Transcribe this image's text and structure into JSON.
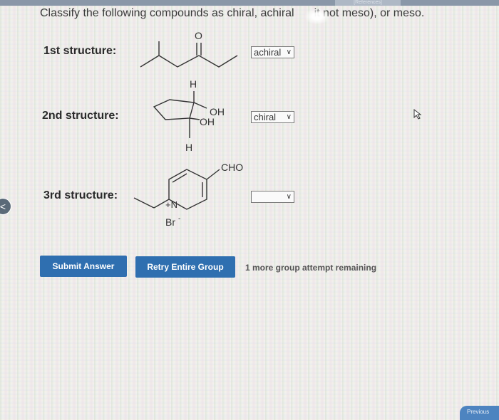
{
  "header": {
    "tab_text": "[References]"
  },
  "question": {
    "text_before": "Classify the following compounds as chiral, achiral",
    "text_after": "it not meso), or meso."
  },
  "structures": [
    {
      "label": "1st structure:",
      "selected": "achiral",
      "atoms": [
        "O"
      ]
    },
    {
      "label": "2nd structure:",
      "selected": "chiral",
      "atoms": [
        "H",
        "OH",
        "OH",
        "H"
      ]
    },
    {
      "label": "3rd structure:",
      "selected": "",
      "atoms": [
        "CHO",
        "+N",
        "Br",
        "-"
      ]
    }
  ],
  "buttons": {
    "submit": "Submit Answer",
    "retry": "Retry Entire Group"
  },
  "attempts_text": "1 more group attempt remaining",
  "nav": {
    "prev_glyph": "<"
  },
  "footer": {
    "corner_text": "Previous"
  },
  "colors": {
    "button_blue": "#2f6fb0",
    "select_border": "#7a7a7a"
  }
}
